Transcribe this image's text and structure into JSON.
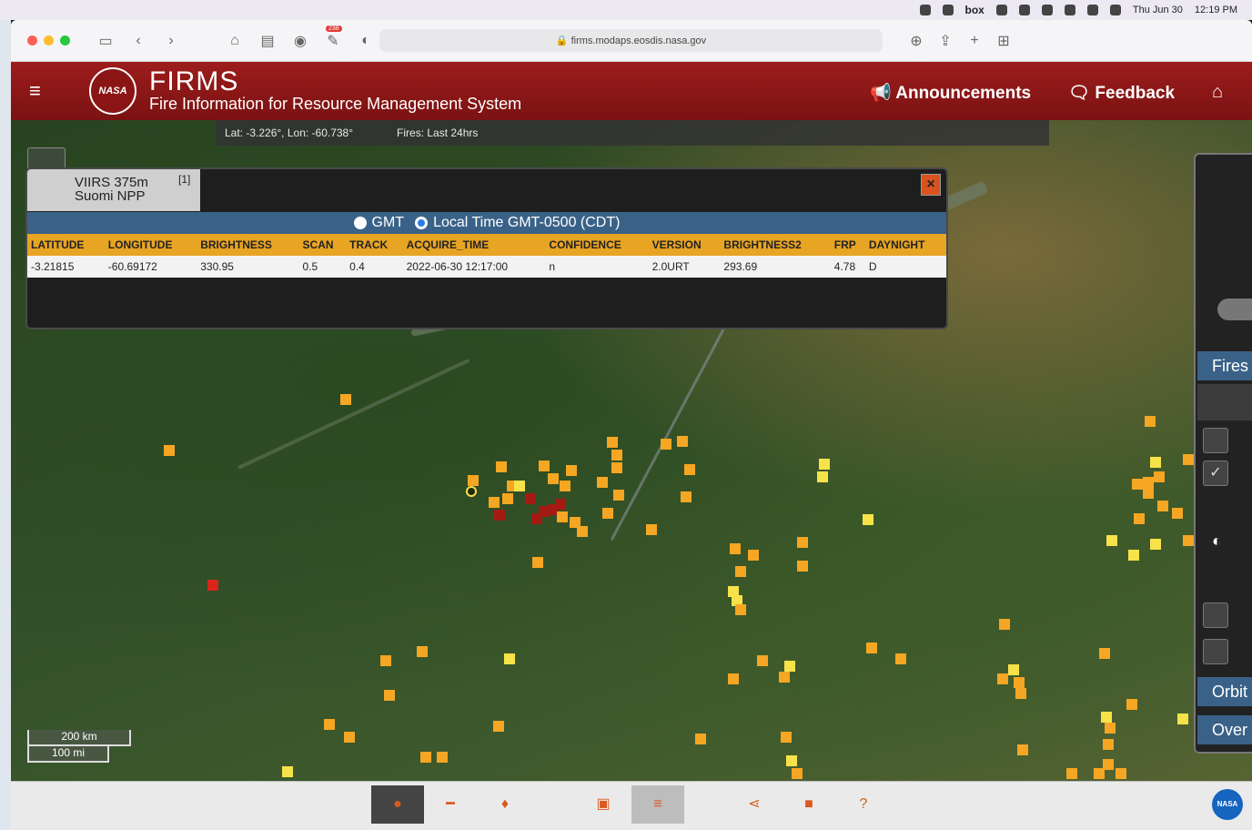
{
  "menubar": {
    "date": "Thu Jun 30",
    "time": "12:19 PM",
    "box_label": "box"
  },
  "browser": {
    "url": "firms.modaps.eosdis.nasa.gov",
    "notification_count": "238"
  },
  "header": {
    "title": "FIRMS",
    "subtitle": "Fire Information for Resource Management System",
    "nasa_logo_text": "NASA",
    "announcements": "Announcements",
    "feedback": "Feedback"
  },
  "coords": {
    "latlon": "Lat: -3.226°, Lon: -60.738°",
    "fires": "Fires: Last 24hrs"
  },
  "popup": {
    "tab_line1": "VIIRS 375m",
    "tab_line2": "Suomi NPP",
    "tab_index": "[1]",
    "close": "×",
    "time_gmt": "GMT",
    "time_local": "Local Time GMT-0500 (CDT)",
    "columns": [
      "LATITUDE",
      "LONGITUDE",
      "BRIGHTNESS",
      "SCAN",
      "TRACK",
      "ACQUIRE_TIME",
      "CONFIDENCE",
      "VERSION",
      "BRIGHTNESS2",
      "FRP",
      "DAYNIGHT"
    ],
    "row": [
      "-3.21815",
      "-60.69172",
      "330.95",
      "0.5",
      "0.4",
      "2022-06-30 12:17:00",
      "n",
      "2.0URT",
      "293.69",
      "4.78",
      "D"
    ]
  },
  "scale": {
    "km": "200 km",
    "mi": "100 mi"
  },
  "side_panel": {
    "fires_label": "Fires",
    "orbit_label": "Orbit",
    "over_label": "Over"
  },
  "icons": [
    "fire-icon",
    "ruler-icon",
    "pin-icon",
    "layers-icon",
    "list-icon",
    "share-icon",
    "camera-icon",
    "help-icon"
  ],
  "colors": {
    "header_red": "#9d1c1c",
    "table_header": "#e8a423",
    "accent_blue": "#3a6288"
  }
}
